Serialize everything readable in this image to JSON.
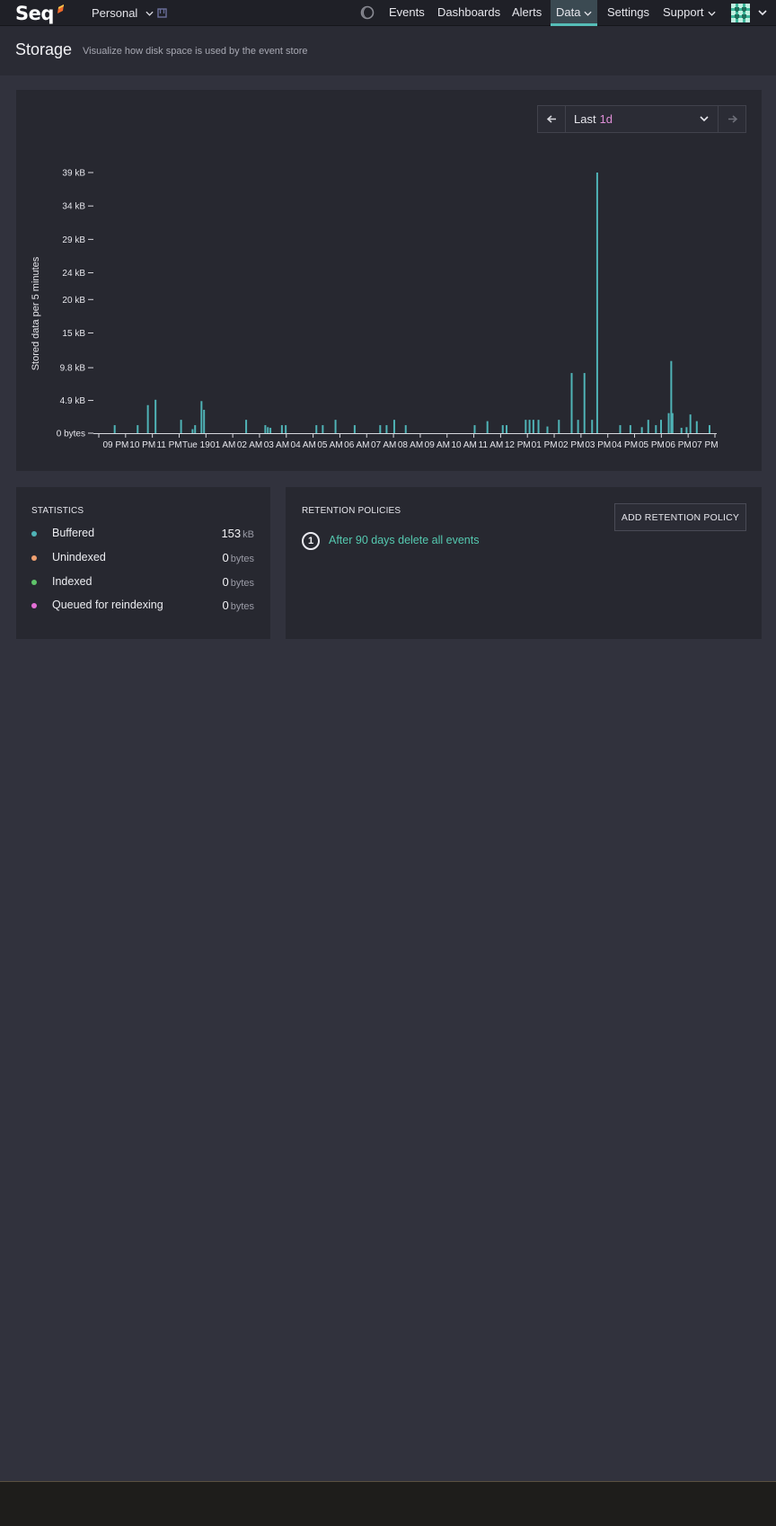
{
  "app": {
    "logo_text": "Seq",
    "workspace": "Personal"
  },
  "nav": {
    "items": [
      "Events",
      "Dashboards",
      "Alerts",
      "Data",
      "Settings",
      "Support"
    ],
    "active": "Data"
  },
  "page": {
    "title": "Storage",
    "subtitle": "Visualize how disk space is used by the event store"
  },
  "range": {
    "prefix": "Last",
    "value": "1d"
  },
  "chart_data": {
    "type": "bar",
    "ylabel": "Stored data per 5 minutes",
    "y_ticks": [
      "0 bytes",
      "4.9 kB",
      "9.8 kB",
      "15 kB",
      "20 kB",
      "24 kB",
      "29 kB",
      "34 kB",
      "39 kB"
    ],
    "y_tick_values": [
      0,
      4.9,
      9.8,
      15,
      20,
      24,
      29,
      34,
      39
    ],
    "ylim": [
      0,
      39
    ],
    "x_tick_labels": [
      "09 PM",
      "10 PM",
      "11 PM",
      "Tue 19",
      "01 AM",
      "02 AM",
      "03 AM",
      "04 AM",
      "05 AM",
      "06 AM",
      "07 AM",
      "08 AM",
      "09 AM",
      "10 AM",
      "11 AM",
      "12 PM",
      "01 PM",
      "02 PM",
      "03 PM",
      "04 PM",
      "05 PM",
      "06 PM",
      "07 PM"
    ],
    "x_range_hours": [
      0,
      23.5
    ],
    "bar_color": "#4fb3b6",
    "bars": [
      {
        "t": 0.2,
        "v": 1.2
      },
      {
        "t": 1.1,
        "v": 1.2
      },
      {
        "t": 1.5,
        "v": 4.2
      },
      {
        "t": 1.8,
        "v": 5.0
      },
      {
        "t": 2.8,
        "v": 2.0
      },
      {
        "t": 3.25,
        "v": 0.6
      },
      {
        "t": 3.35,
        "v": 1.2
      },
      {
        "t": 3.6,
        "v": 4.8
      },
      {
        "t": 3.7,
        "v": 3.5
      },
      {
        "t": 5.35,
        "v": 2.0
      },
      {
        "t": 6.1,
        "v": 1.2
      },
      {
        "t": 6.2,
        "v": 0.9
      },
      {
        "t": 6.3,
        "v": 0.8
      },
      {
        "t": 6.75,
        "v": 1.2
      },
      {
        "t": 6.9,
        "v": 1.2
      },
      {
        "t": 8.1,
        "v": 1.2
      },
      {
        "t": 8.35,
        "v": 1.2
      },
      {
        "t": 8.85,
        "v": 2.0
      },
      {
        "t": 9.6,
        "v": 1.2
      },
      {
        "t": 10.6,
        "v": 1.2
      },
      {
        "t": 10.85,
        "v": 1.2
      },
      {
        "t": 11.15,
        "v": 2.0
      },
      {
        "t": 11.6,
        "v": 1.2
      },
      {
        "t": 14.3,
        "v": 1.2
      },
      {
        "t": 14.8,
        "v": 1.8
      },
      {
        "t": 15.4,
        "v": 1.2
      },
      {
        "t": 15.55,
        "v": 1.2
      },
      {
        "t": 16.3,
        "v": 2.0
      },
      {
        "t": 16.45,
        "v": 2.0
      },
      {
        "t": 16.6,
        "v": 2.0
      },
      {
        "t": 16.8,
        "v": 2.0
      },
      {
        "t": 17.15,
        "v": 1.0
      },
      {
        "t": 17.6,
        "v": 2.0
      },
      {
        "t": 18.1,
        "v": 9.0
      },
      {
        "t": 18.35,
        "v": 2.0
      },
      {
        "t": 18.6,
        "v": 9.0
      },
      {
        "t": 18.9,
        "v": 2.0
      },
      {
        "t": 19.1,
        "v": 39.0
      },
      {
        "t": 20.0,
        "v": 1.2
      },
      {
        "t": 20.4,
        "v": 1.2
      },
      {
        "t": 20.85,
        "v": 0.9
      },
      {
        "t": 21.1,
        "v": 2.0
      },
      {
        "t": 21.4,
        "v": 1.2
      },
      {
        "t": 21.6,
        "v": 2.0
      },
      {
        "t": 21.9,
        "v": 3.0
      },
      {
        "t": 22.0,
        "v": 10.8
      },
      {
        "t": 22.05,
        "v": 3.0
      },
      {
        "t": 22.4,
        "v": 0.8
      },
      {
        "t": 22.6,
        "v": 0.9
      },
      {
        "t": 22.75,
        "v": 2.8
      },
      {
        "t": 23.0,
        "v": 1.8
      },
      {
        "t": 23.5,
        "v": 1.2
      }
    ]
  },
  "statistics": {
    "title": "STATISTICS",
    "rows": [
      {
        "label": "Buffered",
        "value": "153",
        "unit": "kB",
        "color": "#4fb3b6"
      },
      {
        "label": "Unindexed",
        "value": "0",
        "unit": "bytes",
        "color": "#f0a070"
      },
      {
        "label": "Indexed",
        "value": "0",
        "unit": "bytes",
        "color": "#5fc46a"
      },
      {
        "label": "Queued for reindexing",
        "value": "0",
        "unit": "bytes",
        "color": "#e46fd6"
      }
    ]
  },
  "retention": {
    "title": "RETENTION POLICIES",
    "add_button": "ADD RETENTION POLICY",
    "policies": [
      {
        "number": "1",
        "text": "After 90 days delete all events"
      }
    ]
  },
  "icons": {
    "theme": "moon-icon",
    "prev": "arrow-left-icon",
    "next": "arrow-right-icon",
    "workspace": "database-icon"
  }
}
